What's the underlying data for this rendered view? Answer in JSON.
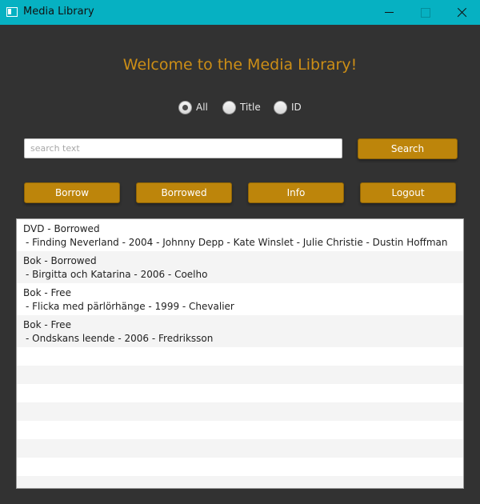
{
  "window": {
    "title": "Media Library"
  },
  "header": {
    "welcome": "Welcome to the Media Library!"
  },
  "filter": {
    "options": [
      {
        "label": "All",
        "checked": true
      },
      {
        "label": "Title",
        "checked": false
      },
      {
        "label": "ID",
        "checked": false
      }
    ]
  },
  "search": {
    "placeholder": "search text",
    "value": "",
    "button_label": "Search"
  },
  "actions": {
    "borrow": "Borrow",
    "borrowed": "Borrowed",
    "info": "Info",
    "logout": "Logout"
  },
  "list": {
    "items": [
      {
        "line1": "DVD - Borrowed",
        "line2": "- Finding Neverland - 2004 - Johnny Depp - Kate Winslet - Julie Christie - Dustin Hoffman"
      },
      {
        "line1": "Bok - Borrowed",
        "line2": "- Birgitta och Katarina - 2006 - Coelho"
      },
      {
        "line1": "Bok - Free",
        "line2": "- Flicka med pärlörhänge - 1999 - Chevalier"
      },
      {
        "line1": "Bok - Free",
        "line2": "- Ondskans leende - 2006 - Fredriksson"
      }
    ]
  },
  "colors": {
    "titlebar": "#06b1c2",
    "background": "#323232",
    "accent": "#bd850b",
    "welcome_text": "#cc8e16"
  }
}
